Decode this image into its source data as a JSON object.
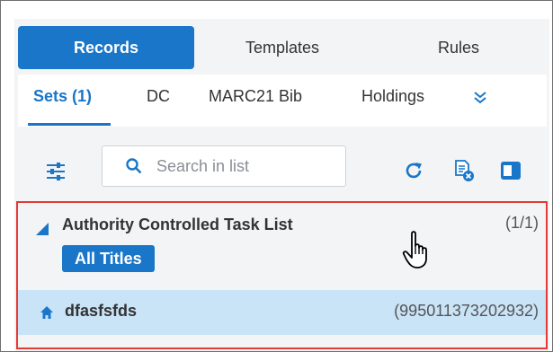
{
  "top_tabs": [
    {
      "label": "Records",
      "active": true
    },
    {
      "label": "Templates",
      "active": false
    },
    {
      "label": "Rules",
      "active": false
    }
  ],
  "sub_tabs": [
    {
      "label": "Sets (1)",
      "active": true
    },
    {
      "label": "DC",
      "active": false
    },
    {
      "label": "MARC21 Bib",
      "active": false
    },
    {
      "label": "Holdings",
      "active": false
    }
  ],
  "icons": {
    "more": "double-chevron-down-icon",
    "filter": "sliders-icon",
    "search": "search-icon",
    "refresh": "refresh-icon",
    "doc_remove": "document-remove-icon",
    "panel": "panel-toggle-icon",
    "caret": "caret-icon",
    "home": "home-icon",
    "cursor": "hand-pointer-icon"
  },
  "search": {
    "placeholder": "Search in list"
  },
  "list": {
    "group": {
      "title": "Authority Controlled Task List",
      "count": "(1/1)",
      "badge": "All Titles"
    },
    "items": [
      {
        "title": "dfasfsfds",
        "id": "(995011373202932)"
      }
    ]
  },
  "colors": {
    "accent": "#1976c8",
    "highlight_border": "#e53935",
    "selected_row": "#c9e3f7",
    "panel_bg": "#f3f4f6"
  }
}
